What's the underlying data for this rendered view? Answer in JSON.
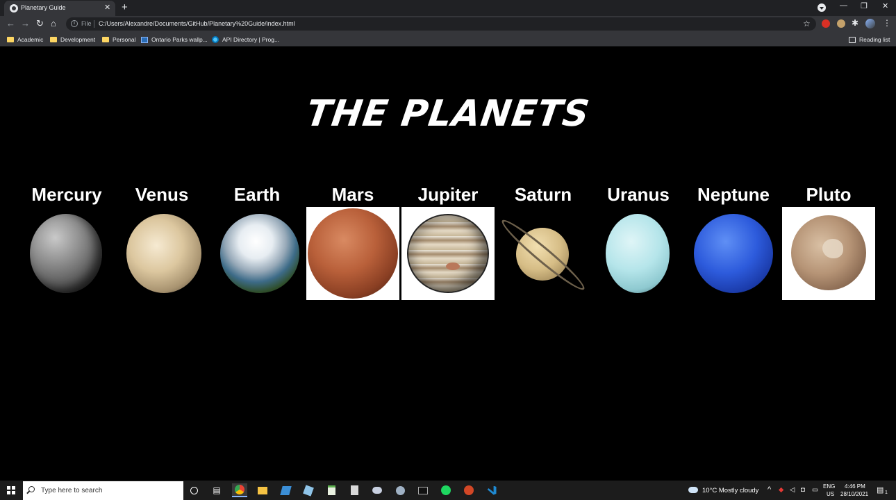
{
  "browser": {
    "tab_title": "Planetary Guide",
    "tab_close": "✕",
    "new_tab": "+",
    "url_scheme": "File",
    "url": "C:/Users/Alexandre/Documents/GitHub/Planetary%20Guide/index.html",
    "bookmarks": [
      "Academic",
      "Development",
      "Personal",
      "Ontario Parks wallp...",
      "API Directory | Prog..."
    ],
    "reading_list": "Reading list"
  },
  "page": {
    "title": "THE PLANETS",
    "planets": [
      {
        "name": "Mercury"
      },
      {
        "name": "Venus"
      },
      {
        "name": "Earth"
      },
      {
        "name": "Mars"
      },
      {
        "name": "Jupiter"
      },
      {
        "name": "Saturn"
      },
      {
        "name": "Uranus"
      },
      {
        "name": "Neptune"
      },
      {
        "name": "Pluto"
      }
    ]
  },
  "taskbar": {
    "search_placeholder": "Type here to search",
    "weather": "10°C  Mostly cloudy",
    "lang_top": "ENG",
    "lang_bottom": "US",
    "time": "4:46 PM",
    "date": "28/10/2021",
    "notification_count": "1"
  },
  "colors": {
    "page_background": "#000000",
    "chrome_dark": "#202124",
    "chrome_toolbar": "#35363a"
  }
}
